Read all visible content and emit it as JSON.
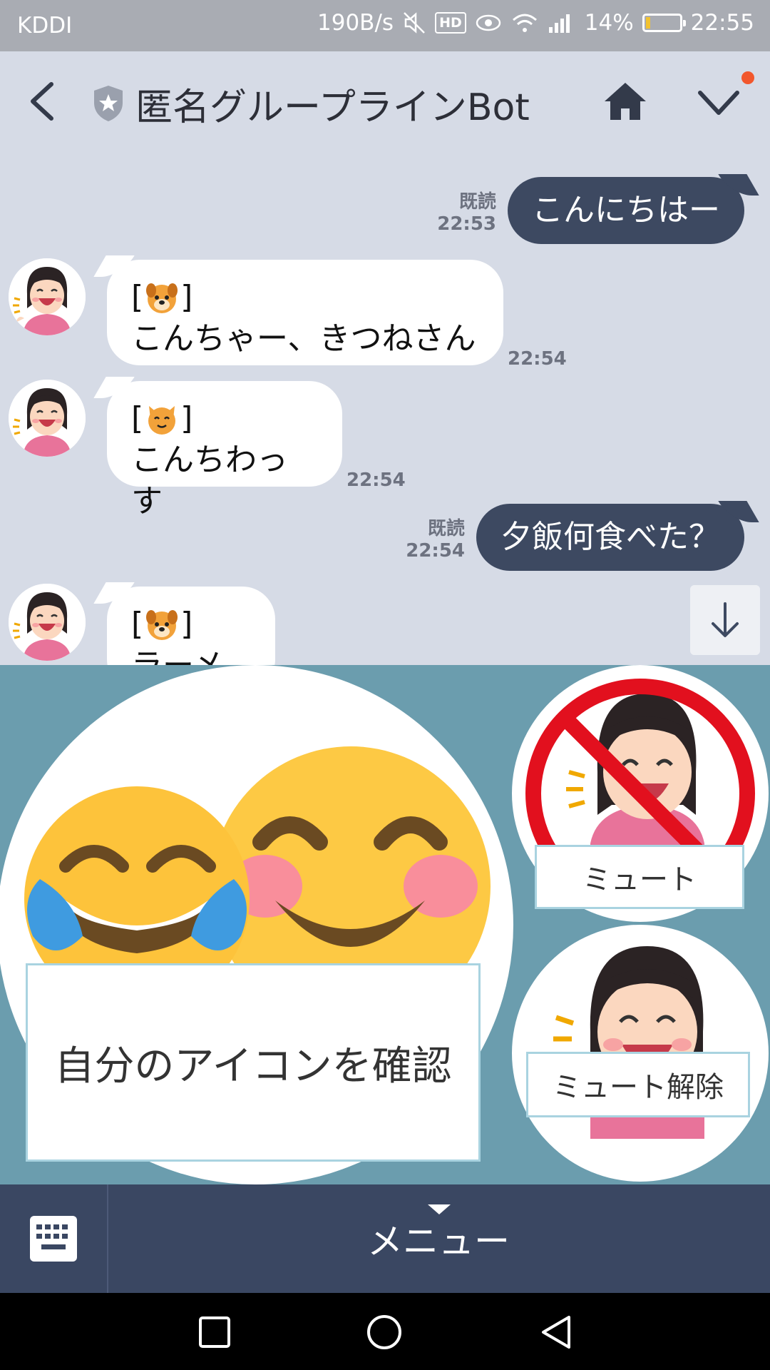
{
  "status_bar": {
    "carrier": "KDDI",
    "net_speed": "190B/s",
    "hd": "HD",
    "battery": "14%",
    "battery_level": 0.14,
    "time": "22:55"
  },
  "header": {
    "title": "匿名グループラインBot",
    "icons": [
      "chevron-left-icon",
      "shield-star-icon",
      "home-icon",
      "chevron-down-icon"
    ],
    "notification_color": "#f2572d"
  },
  "messages": [
    {
      "direction": "out",
      "text": "こんにちはー",
      "read": "既読",
      "time": "22:53"
    },
    {
      "direction": "in",
      "tag_open": "[",
      "tag_emoji": "dog-face-icon",
      "tag_close": "]",
      "text": "こんちゃー、きつねさん",
      "time": "22:54"
    },
    {
      "direction": "in",
      "tag_open": "[",
      "tag_emoji": "cat-face-icon",
      "tag_close": "]",
      "text": "こんちわっす",
      "time": "22:54"
    },
    {
      "direction": "out",
      "text": "夕飯何食べた？",
      "read": "既読",
      "time": "22:54"
    },
    {
      "direction": "in",
      "tag_open": "[",
      "tag_emoji": "dog-face-icon",
      "tag_close": "]",
      "text": "ラーメン",
      "time": ""
    }
  ],
  "rich_menu": {
    "check_icon": "自分のアイコンを確認",
    "mute": "ミュート",
    "unmute": "ミュート解除"
  },
  "menu_bar": {
    "label": "メニュー"
  },
  "colors": {
    "chat_bg": "#d6dbe6",
    "outgoing_bubble": "#3d4961",
    "rich_menu_bg": "#6b9dae",
    "menu_bar": "#3a4762"
  }
}
